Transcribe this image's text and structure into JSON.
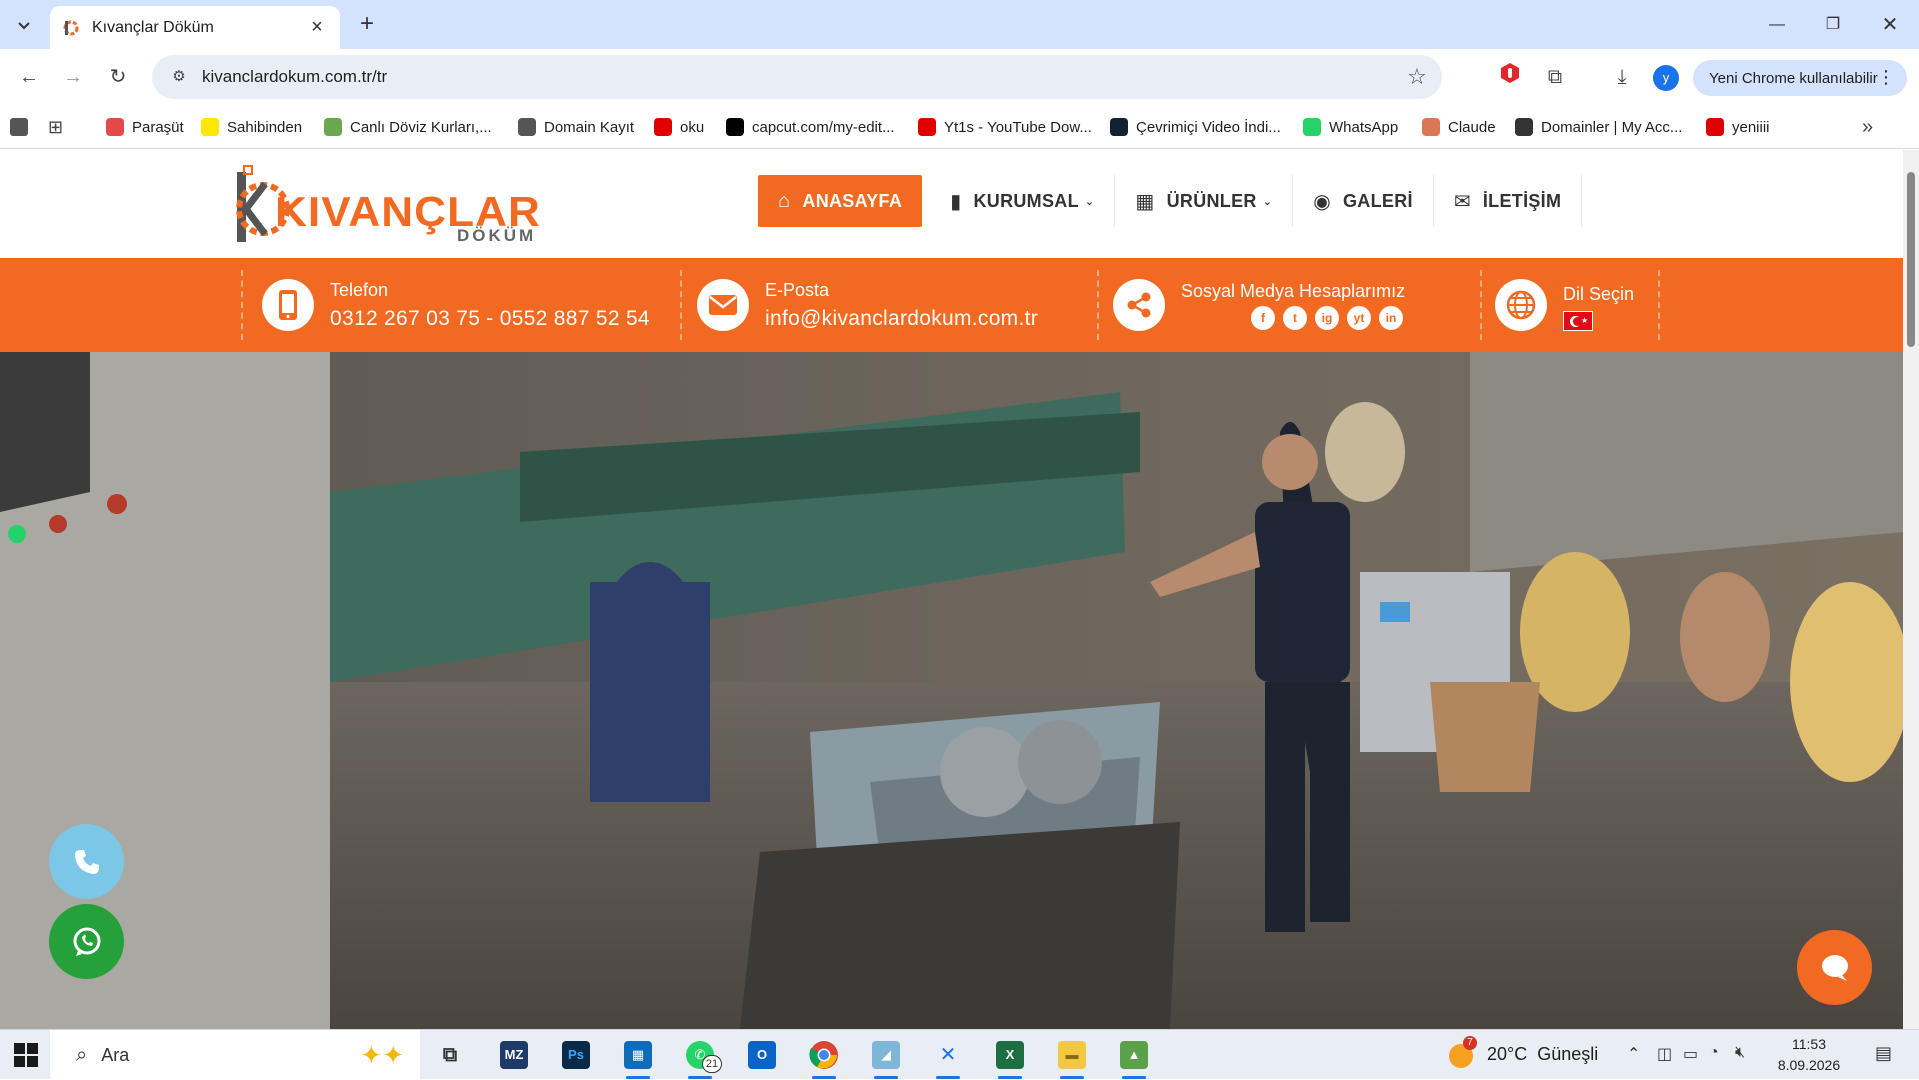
{
  "browser": {
    "tab_title": "Kıvançlar Döküm",
    "url": "kivanclardokum.com.tr/tr",
    "profile_initial": "y",
    "update_label": "Yeni Chrome kullanılabilir"
  },
  "bookmarks": [
    {
      "label": "Paraşüt",
      "color": "#e24a4a",
      "icon": "parasut-icon"
    },
    {
      "label": "Sahibinden",
      "color": "#ffe800",
      "icon": "sahibinden-icon"
    },
    {
      "label": "Canlı Döviz Kurları,...",
      "color": "#6aa84f",
      "icon": "doviz-icon"
    },
    {
      "label": "Domain Kayıt",
      "color": "#555555",
      "icon": "globe-icon"
    },
    {
      "label": "oku",
      "color": "#e00000",
      "icon": "drop-icon"
    },
    {
      "label": "capcut.com/my-edit...",
      "color": "#000000",
      "icon": "capcut-icon"
    },
    {
      "label": "Yt1s - YouTube Dow...",
      "color": "#e00000",
      "icon": "yt1s-icon"
    },
    {
      "label": "Çevrimiçi Video İndi...",
      "color": "#123",
      "icon": "video-icon"
    },
    {
      "label": "WhatsApp",
      "color": "#25d366",
      "icon": "whatsapp-icon"
    },
    {
      "label": "Claude",
      "color": "#d97757",
      "icon": "claude-icon"
    },
    {
      "label": "Domainler | My Acc...",
      "color": "#333333",
      "icon": "wix-icon"
    },
    {
      "label": "yeniiii",
      "color": "#e00000",
      "icon": "yt-icon"
    }
  ],
  "site": {
    "logo_main": "KIVANÇLAR",
    "logo_sub": "DÖKÜM",
    "nav": [
      {
        "label": "ANASAYFA",
        "icon": "home-icon",
        "active": true
      },
      {
        "label": "KURUMSAL",
        "icon": "badge-icon",
        "dropdown": true
      },
      {
        "label": "ÜRÜNLER",
        "icon": "box-icon",
        "dropdown": true
      },
      {
        "label": "GALERİ",
        "icon": "camera-icon"
      },
      {
        "label": "İLETİŞİM",
        "icon": "envelope-icon"
      }
    ],
    "info": {
      "phone_label": "Telefon",
      "phone_value": "0312 267 03 75 - 0552 887 52 54",
      "email_label": "E-Posta",
      "email_value": "info@kivanclardokum.com.tr",
      "social_label": "Sosyal Medya Hesaplarımız",
      "social": [
        "f",
        "t",
        "ig",
        "yt",
        "in"
      ],
      "lang_label": "Dil Seçin"
    },
    "accent": "#f26a22"
  },
  "taskbar": {
    "search_label": "Ara",
    "whatsapp_badge": "21",
    "weather_badge": "7",
    "weather_text": "20°C  Güneşli",
    "time": "11:53",
    "date": "8.09.2026"
  }
}
